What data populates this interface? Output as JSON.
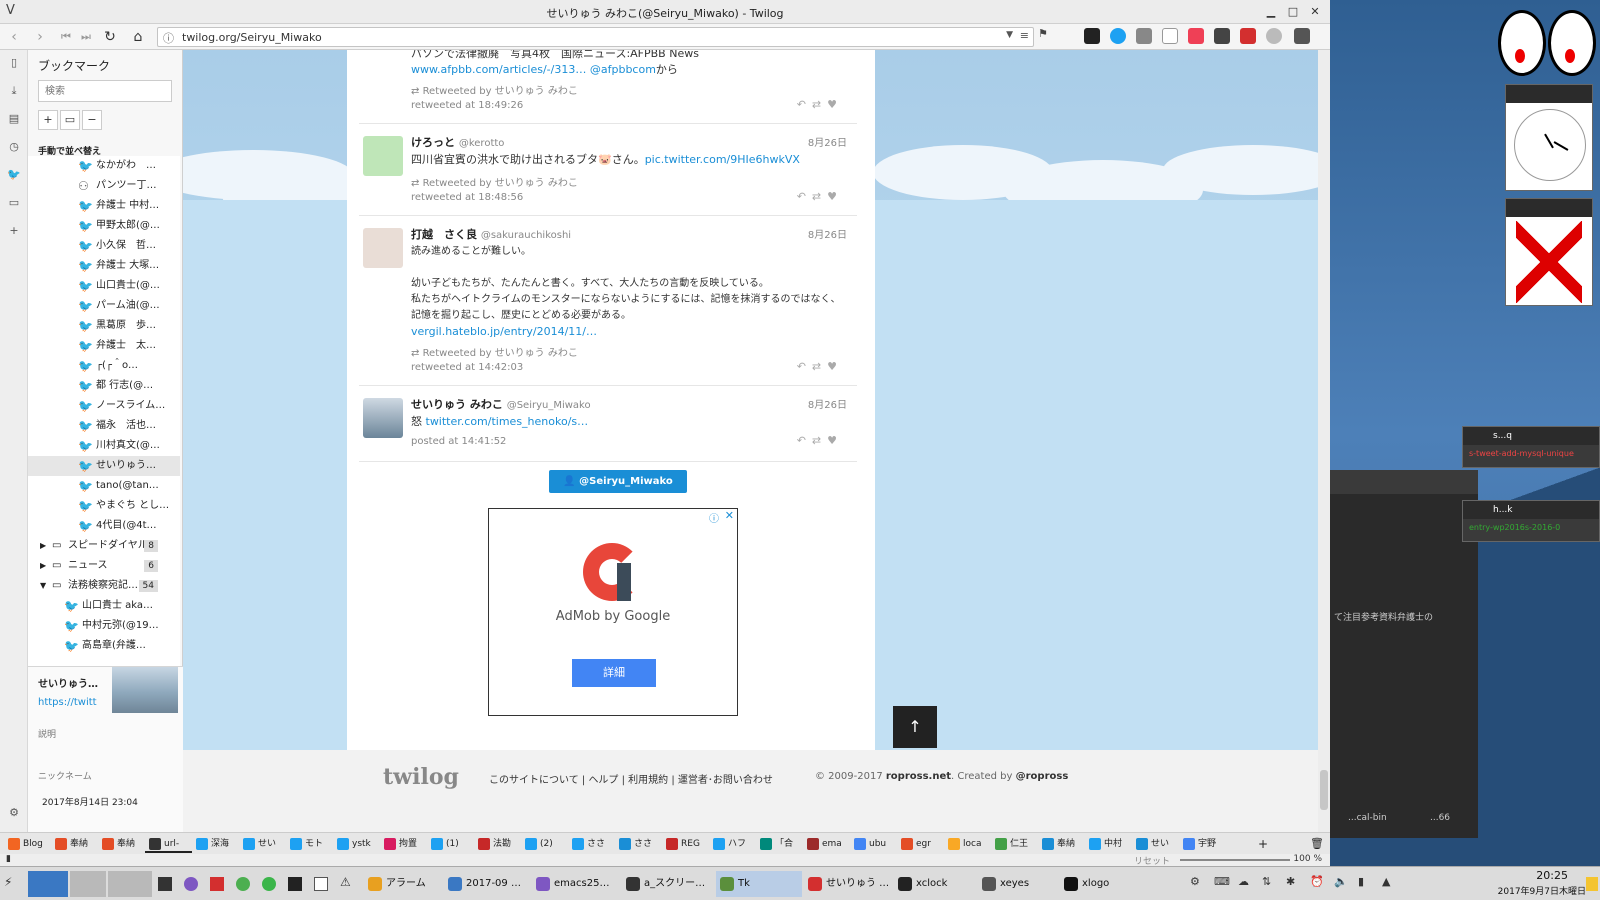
{
  "window": {
    "title": "せいりゅう みわこ(@Seiryu_Miwako) - Twilog",
    "app_letter": "V"
  },
  "navbar": {
    "url": "twilog.org/Seiryu_Miwako"
  },
  "sidebar": {
    "title": "ブックマーク",
    "search_placeholder": "検索",
    "sort_label": "手動で並べ替え",
    "items": [
      {
        "label": "なかがわ　…",
        "icon": "twitter"
      },
      {
        "label": "パンツー丁…",
        "icon": "person"
      },
      {
        "label": "弁護士 中村…",
        "icon": "twitter"
      },
      {
        "label": "甲野太郎(@…",
        "icon": "twitter"
      },
      {
        "label": "小久保　哲…",
        "icon": "twitter"
      },
      {
        "label": "弁護士 大塚…",
        "icon": "twitter"
      },
      {
        "label": "山口貴士(@…",
        "icon": "twitter"
      },
      {
        "label": "パーム油(@…",
        "icon": "twitter"
      },
      {
        "label": "黒葛原　歩…",
        "icon": "twitter"
      },
      {
        "label": "弁護士　太…",
        "icon": "twitter"
      },
      {
        "label": "┌(┌＾o…",
        "icon": "twitter"
      },
      {
        "label": "都 行志(@…",
        "icon": "twitter"
      },
      {
        "label": "ノースライム…",
        "icon": "twitter"
      },
      {
        "label": "福永　活也…",
        "icon": "twitter"
      },
      {
        "label": "川村真文(@…",
        "icon": "twitter"
      },
      {
        "label": "せいりゅう…",
        "icon": "twitter",
        "selected": true
      },
      {
        "label": "tano(@tan…",
        "icon": "twitter"
      },
      {
        "label": "やまぐち とし…",
        "icon": "twitter"
      },
      {
        "label": "4代目(@4t…",
        "icon": "twitter"
      }
    ],
    "folders": [
      {
        "label": "スピードダイヤル",
        "count": "8",
        "open": false
      },
      {
        "label": "ニュース",
        "count": "6",
        "open": false
      },
      {
        "label": "法務検察宛記…",
        "count": "54",
        "open": true
      }
    ],
    "sub_items": [
      {
        "label": "山口貴士 aka…"
      },
      {
        "label": "中村元弥(@19…"
      },
      {
        "label": "高島章(弁護…"
      }
    ],
    "detail": {
      "name": "せいりゅう…",
      "url": "https://twitt",
      "desc_label": "説明",
      "nick_label": "ニックネーム",
      "date": "2017年8月14日 23:04"
    }
  },
  "tweets": [
    {
      "partial": true,
      "body_top": "パソンで法律撤廃　写真4枚　国際ニュース:AFPBB News",
      "link": "www.afpbb.com/articles/-/313…",
      "link2": "@afpbbcom",
      "suffix": "から",
      "rt": "Retweeted by せいりゅう みわこ",
      "time": "retweeted at 18:49:26"
    },
    {
      "name": "けろっと",
      "handle": "@kerotto",
      "date": "8月26日",
      "body": "四川省宜賓の洪水で助け出されるブタ🐷さん。",
      "link": "pic.twitter.com/9HIe6hwkVX",
      "rt": "Retweeted by せいりゅう みわこ",
      "time": "retweeted at 18:48:56"
    },
    {
      "name": "打越　さく良",
      "handle": "@sakurauchikoshi",
      "date": "8月26日",
      "line1": "読み進めることが難しい。",
      "line2": "幼い子どもたちが、たんたんと書く。すべて、大人たちの言動を反映している。",
      "line3": "私たちがヘイトクライムのモンスターにならないようにするには、記憶を抹消するのではなく、",
      "line4": "記憶を掘り起こし、歴史にとどめる必要がある。",
      "link": "vergil.hateblo.jp/entry/2014/11/…",
      "rt": "Retweeted by せいりゅう みわこ",
      "time": "retweeted at 14:42:03"
    },
    {
      "name": "せいりゅう みわこ",
      "handle": "@Seiryu_Miwako",
      "date": "8月26日",
      "body": "怒",
      "link": "twitter.com/times_henoko/s…",
      "time": "posted at 14:41:52"
    }
  ],
  "profile_button": "@Seiryu_Miwako",
  "ad": {
    "brand": "AdMob by Google",
    "button": "詳細"
  },
  "footer": {
    "logo": "twilog",
    "links": [
      "このサイトについて",
      "ヘルプ",
      "利用規約",
      "運営者･お問い合わせ"
    ],
    "copy": "© 2009-2017",
    "copy_site": "ropross.net",
    "copy_mid": ". Created by",
    "copy_author": "@ropross"
  },
  "tabs": [
    {
      "label": "Blog",
      "color": "#f26522"
    },
    {
      "label": "奉納",
      "color": "#e44d26"
    },
    {
      "label": "奉納",
      "color": "#e44d26"
    },
    {
      "label": "url-",
      "color": "#333333"
    },
    {
      "label": "深海",
      "color": "#1da1f2"
    },
    {
      "label": "せい",
      "color": "#1da1f2"
    },
    {
      "label": "モト",
      "color": "#1da1f2"
    },
    {
      "label": "ystk",
      "color": "#1da1f2"
    },
    {
      "label": "拘置",
      "color": "#d81b60"
    },
    {
      "label": "(1)",
      "color": "#1da1f2"
    },
    {
      "label": "法勘",
      "color": "#c62828"
    },
    {
      "label": "(2)",
      "color": "#1da1f2"
    },
    {
      "label": "ささ",
      "color": "#1da1f2"
    },
    {
      "label": "ささ",
      "color": "#1a8ed6"
    },
    {
      "label": "REG",
      "color": "#c62828"
    },
    {
      "label": "ハフ",
      "color": "#1da1f2"
    },
    {
      "label": "「合",
      "color": "#00897b"
    },
    {
      "label": "ema",
      "color": "#9c2a2a"
    },
    {
      "label": "ubu",
      "color": "#4285f4"
    },
    {
      "label": "egr",
      "color": "#e44d26"
    },
    {
      "label": "loca",
      "color": "#f9a825"
    },
    {
      "label": "仁王",
      "color": "#43a047"
    },
    {
      "label": "奉納",
      "color": "#1a8ed6"
    },
    {
      "label": "中村",
      "color": "#1da1f2"
    },
    {
      "label": "せい",
      "color": "#1a8ed6"
    },
    {
      "label": "宇野",
      "color": "#4285f4"
    }
  ],
  "status": {
    "reset": "リセット",
    "zoom": "100 %"
  },
  "desktop": {
    "win1_title": "s...q",
    "win1_text": "s-tweet-add-mysql-unique",
    "win2_title": "h...k",
    "win2_text": "entry-wp2016s-2016-0",
    "term_text": "て注目参考資料弁護士の",
    "bin1": "...cal-bin",
    "bin2": "...66"
  },
  "taskbar": {
    "items": [
      {
        "label": "アラーム",
        "color": "#e8a020"
      },
      {
        "label": "2017-09 …",
        "color": "#3a78c3"
      },
      {
        "label": "emacs25…",
        "color": "#7e57c2"
      },
      {
        "label": "a_スクリー…",
        "color": "#333333"
      },
      {
        "label": "Tk",
        "color": "#5b8f3c"
      },
      {
        "label": "せいりゅう …",
        "color": "#d32f2f"
      },
      {
        "label": "xclock",
        "color": "#222222"
      },
      {
        "label": "xeyes",
        "color": "#555555"
      },
      {
        "label": "xlogo",
        "color": "#111111"
      }
    ],
    "time": "20:25",
    "date": "2017年9月7日木曜日"
  }
}
